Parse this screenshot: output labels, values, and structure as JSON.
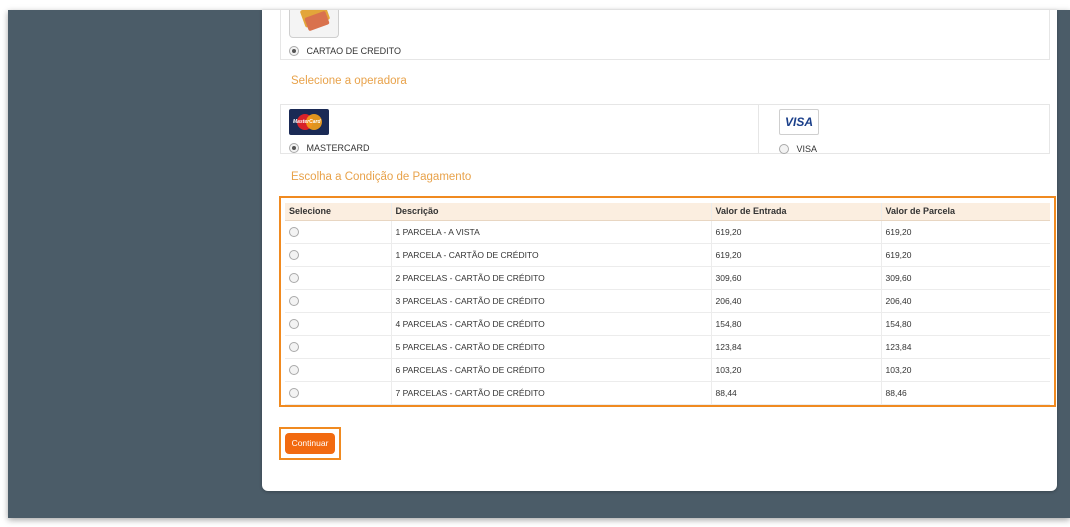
{
  "payment_method": {
    "label": "CARTAO DE CREDITO",
    "selected": true
  },
  "operator_section": {
    "title": "Selecione a operadora",
    "options": [
      {
        "label": "MASTERCARD",
        "logo_text": "MasterCard",
        "selected": true
      },
      {
        "label": "VISA",
        "logo_text": "VISA",
        "selected": false
      }
    ]
  },
  "condition_section": {
    "title": "Escolha a Condição de Pagamento",
    "headers": [
      "Selecione",
      "Descrição",
      "Valor de Entrada",
      "Valor de Parcela"
    ],
    "rows": [
      {
        "desc": "1 PARCELA - A VISTA",
        "entrada": "619,20",
        "parcela": "619,20"
      },
      {
        "desc": "1 PARCELA - CARTÃO DE CRÉDITO",
        "entrada": "619,20",
        "parcela": "619,20"
      },
      {
        "desc": "2 PARCELAS - CARTÃO DE CRÉDITO",
        "entrada": "309,60",
        "parcela": "309,60"
      },
      {
        "desc": "3 PARCELAS - CARTÃO DE CRÉDITO",
        "entrada": "206,40",
        "parcela": "206,40"
      },
      {
        "desc": "4 PARCELAS - CARTÃO DE CRÉDITO",
        "entrada": "154,80",
        "parcela": "154,80"
      },
      {
        "desc": "5 PARCELAS - CARTÃO DE CRÉDITO",
        "entrada": "123,84",
        "parcela": "123,84"
      },
      {
        "desc": "6 PARCELAS - CARTÃO DE CRÉDITO",
        "entrada": "103,20",
        "parcela": "103,20"
      },
      {
        "desc": "7 PARCELAS - CARTÃO DE CRÉDITO",
        "entrada": "88,44",
        "parcela": "88,46"
      }
    ]
  },
  "continue_button": {
    "label": "Continuar"
  },
  "colors": {
    "accent": "#f08a20",
    "button": "#f26a10",
    "section_title": "#e8a24a",
    "background": "#4b5c68"
  }
}
